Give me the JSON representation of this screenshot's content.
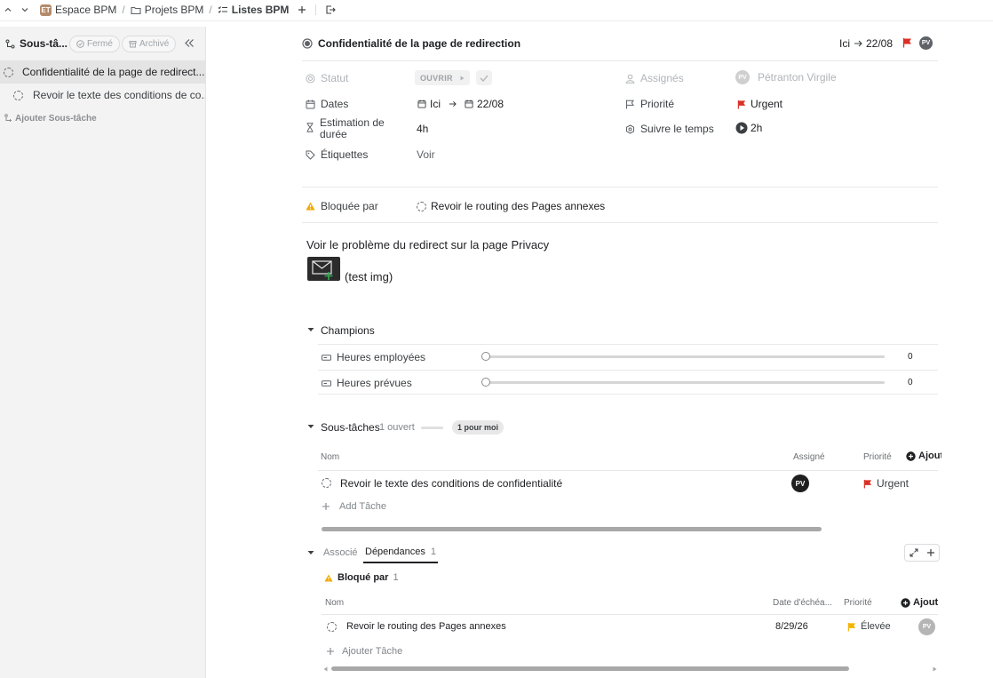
{
  "breadcrumb": {
    "workspace_badge": "ET",
    "workspace": "Espace BPM",
    "folder": "Projets BPM",
    "list": "Listes BPM",
    "separator": "/"
  },
  "sidebar": {
    "title": "Sous-tâ...",
    "filter_closed": "Fermé",
    "filter_archived": "Archivé",
    "items": [
      {
        "label": "Confidentialité de la page de redirect..."
      },
      {
        "label": "Revoir le texte des conditions de co..."
      }
    ],
    "add_label": "Ajouter Sous-tâche"
  },
  "task": {
    "title": "Confidentialité de la page de redirection",
    "date_start": "Ici",
    "date_end": "22/08",
    "assignee_initials": "PV",
    "description": "Voir le problème du redirect sur la page Privacy",
    "image_caption": "(test img)"
  },
  "properties": {
    "status_label": "Statut",
    "status_value": "OUVRIR",
    "dates_label": "Dates",
    "dates_start": "Ici",
    "dates_end": "22/08",
    "estimate_label_1": "Estimation de",
    "estimate_label_2": "durée",
    "estimate_value": "4h",
    "tags_label": "Étiquettes",
    "tags_value": "Voir",
    "assignees_label": "Assignés",
    "assignee_initials": "PV",
    "assignee_name": "Pétranton Virgile",
    "priority_label": "Priorité",
    "priority_value": "Urgent",
    "time_label": "Suivre le temps",
    "time_value": "2h"
  },
  "blocked": {
    "label": "Bloquée par",
    "task": "Revoir le routing des Pages annexes"
  },
  "champions": {
    "title": "Champions",
    "fields": [
      {
        "label": "Heures employées",
        "value": "0",
        "progress": 0
      },
      {
        "label": "Heures prévues",
        "value": "0",
        "progress": 0
      }
    ]
  },
  "subtasks": {
    "title": "Sous-tâches",
    "count": "1 ouvert",
    "mine_badge": "1 pour moi",
    "col_name": "Nom",
    "col_assignee": "Assigné",
    "col_priority": "Priorité",
    "col_add": "Ajout",
    "rows": [
      {
        "name": "Revoir le texte des conditions de confidentialité",
        "assignee": "PV",
        "priority": "Urgent"
      }
    ],
    "add_task": "Add Tâche"
  },
  "deps": {
    "tab_associated": "Associé",
    "tab_dependencies": "Dépendances",
    "tab_dependencies_count": "1",
    "blocked_label": "Bloqué par",
    "blocked_count": "1",
    "col_name": "Nom",
    "col_due": "Date d'échéa...",
    "col_priority": "Priorité",
    "col_add": "Ajout",
    "rows": [
      {
        "name": "Revoir le routing des Pages annexes",
        "due": "8/29/26",
        "priority": "Élevée",
        "assignee": "PV"
      }
    ],
    "add_task": "Ajouter Tâche"
  },
  "colors": {
    "urgent": "#d93025",
    "high": "#f4b400",
    "warning": "#f2a900",
    "workspace_badge": "#b48a6a"
  }
}
